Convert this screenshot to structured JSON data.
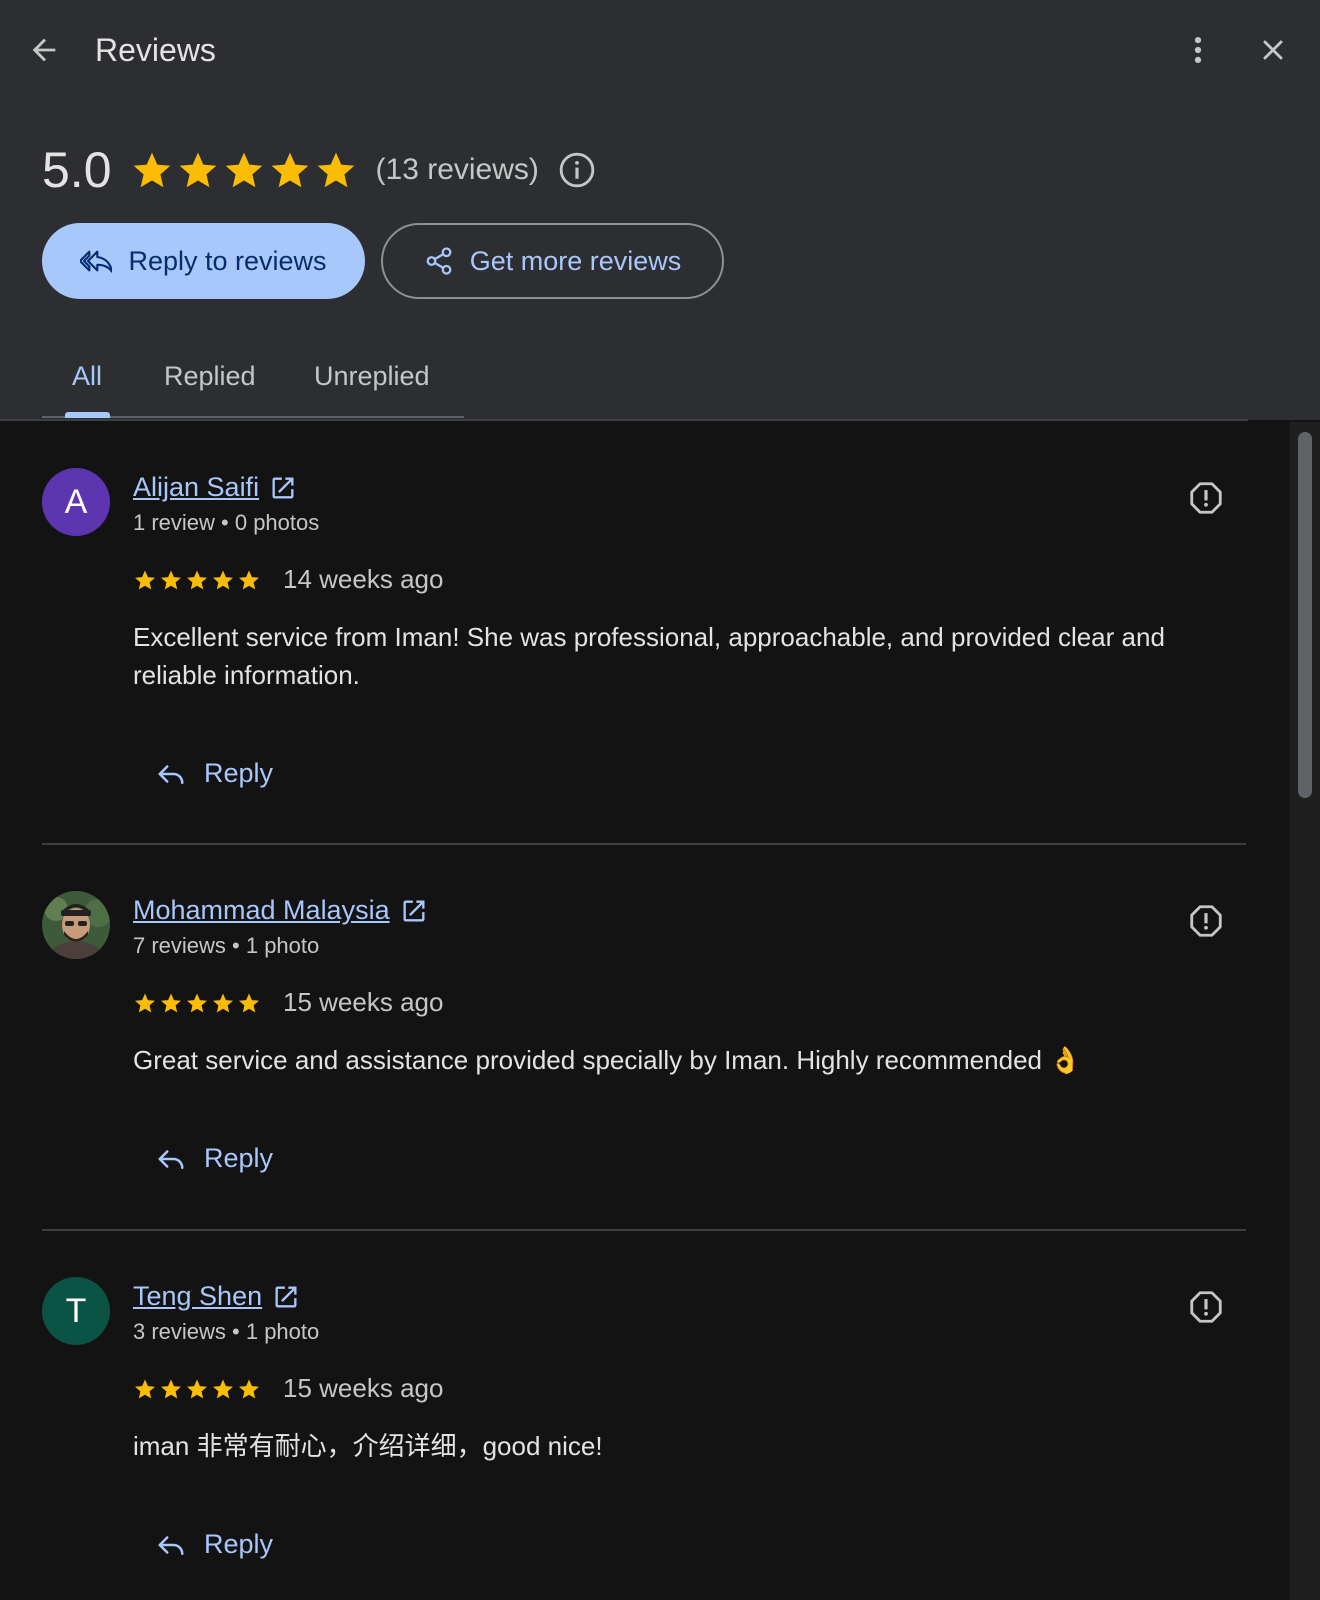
{
  "header": {
    "title": "Reviews"
  },
  "summary": {
    "score": "5.0",
    "stars": 5,
    "review_count": "(13 reviews)"
  },
  "actions": {
    "reply_label": "Reply to reviews",
    "get_more_label": "Get more reviews"
  },
  "tabs": [
    {
      "label": "All",
      "active": true
    },
    {
      "label": "Replied",
      "active": false
    },
    {
      "label": "Unreplied",
      "active": false
    }
  ],
  "colors": {
    "star": "#fbbc04",
    "accent": "#a8c7fa",
    "avatar_a": "#5e35b1",
    "avatar_t": "#0b5345"
  },
  "reviews": [
    {
      "avatar_letter": "A",
      "name": "Alijan Saifi",
      "meta": "1 review • 0 photos",
      "stars": 5,
      "time": "14 weeks ago",
      "text": "Excellent service from Iman! She was professional, approachable, and provided clear and reliable information.",
      "reply_label": "Reply"
    },
    {
      "avatar_letter": "",
      "name": "Mohammad Malaysia",
      "meta": "7 reviews • 1 photo",
      "stars": 5,
      "time": "15 weeks ago",
      "text": "Great service and assistance provided specially by Iman. Highly recommended 👌",
      "reply_label": "Reply"
    },
    {
      "avatar_letter": "T",
      "name": "Teng Shen",
      "meta": "3 reviews • 1 photo",
      "stars": 5,
      "time": "15 weeks ago",
      "text": "iman 非常有耐心，介绍详细，good nice!",
      "reply_label": "Reply"
    }
  ]
}
